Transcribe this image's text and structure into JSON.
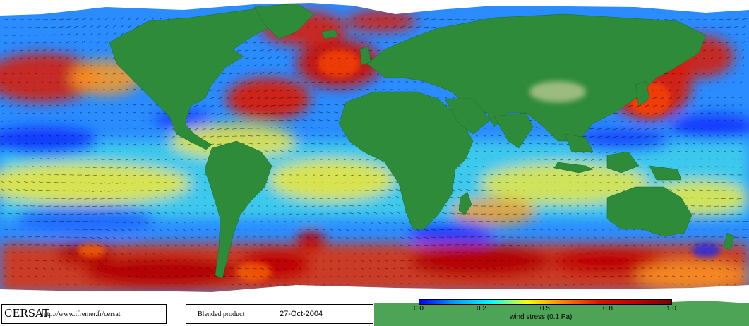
{
  "footer": {
    "brand": "CERSAT",
    "url": "http://www.ifremer.fr/cersat",
    "product": "Blended product",
    "date": "27-Oct-2004"
  },
  "colorbar": {
    "ticks": [
      "0.0",
      "0.2",
      "0.5",
      "0.8",
      "1.0"
    ],
    "tick_values": [
      0.0,
      0.2,
      0.5,
      0.8,
      1.0
    ],
    "title": "wind stress (0.1 Pa)",
    "colors": [
      "#0000ff",
      "#00a0ff",
      "#00ffff",
      "#ffff00",
      "#ff8000",
      "#e01000",
      "#c00000",
      "#7a0000"
    ]
  },
  "map": {
    "ocean_base_color": "#2a8cff",
    "land_color": "#2e8b3a",
    "ice_color": "#ffffff",
    "vector_color": "#000000"
  }
}
